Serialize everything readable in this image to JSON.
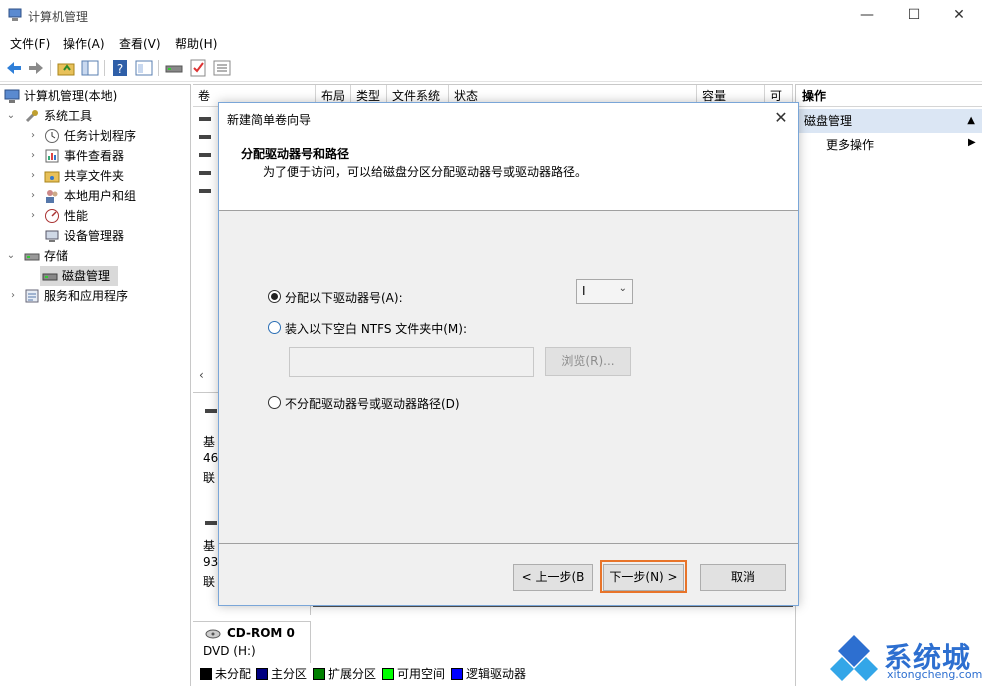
{
  "window": {
    "title": "计算机管理",
    "controls": {
      "minimize": "—",
      "maximize": "☐",
      "close": "✕"
    }
  },
  "menu": [
    "文件(F)",
    "操作(A)",
    "查看(V)",
    "帮助(H)"
  ],
  "toolbar": {
    "icons": [
      "back-icon",
      "forward-icon",
      "folder-up-icon",
      "show-tree-icon",
      "help-icon",
      "properties-icon",
      "disk-icon",
      "check-icon",
      "list-icon"
    ]
  },
  "tree": {
    "root": "计算机管理(本地)",
    "system_tools": "系统工具",
    "task_scheduler": "任务计划程序",
    "event_viewer": "事件查看器",
    "shared_folders": "共享文件夹",
    "local_users": "本地用户和组",
    "performance": "性能",
    "device_manager": "设备管理器",
    "storage": "存储",
    "disk_management": "磁盘管理",
    "services": "服务和应用程序"
  },
  "volume_table": {
    "columns": [
      "卷",
      "布局",
      "类型",
      "文件系统",
      "状态",
      "容量",
      "可"
    ]
  },
  "disks": {
    "disk0_lines": [
      "基",
      "46",
      "联"
    ],
    "disk1_lines": [
      "基",
      "93",
      "联"
    ],
    "cdrom_name": "CD-ROM 0",
    "cdrom_type": "DVD (H:)"
  },
  "legend": [
    {
      "label": "未分配",
      "color": "#000000"
    },
    {
      "label": "主分区",
      "color": "#000080"
    },
    {
      "label": "扩展分区",
      "color": "#008000"
    },
    {
      "label": "可用空间",
      "color": "#00ff00"
    },
    {
      "label": "逻辑驱动器",
      "color": "#0000ff"
    }
  ],
  "actions": {
    "header": "操作",
    "group": "磁盘管理",
    "more": "更多操作"
  },
  "dialog": {
    "title": "新建简单卷向导",
    "heading": "分配驱动器号和路径",
    "subtitle": "为了便于访问，可以给磁盘分区分配驱动器号或驱动器路径。",
    "option_assign": "分配以下驱动器号(A):",
    "option_assign_selected": true,
    "drive_letter": "I",
    "option_mount": "装入以下空白 NTFS 文件夹中(M):",
    "folder_path": "",
    "browse": "浏览(R)...",
    "option_none": "不分配驱动器号或驱动器路径(D)",
    "back": "< 上一步(B",
    "next": "下一步(N) >",
    "cancel": "取消",
    "highlight_color": "#e8742a"
  },
  "watermark": {
    "text": "系统城",
    "url": "xitongcheng.com"
  }
}
